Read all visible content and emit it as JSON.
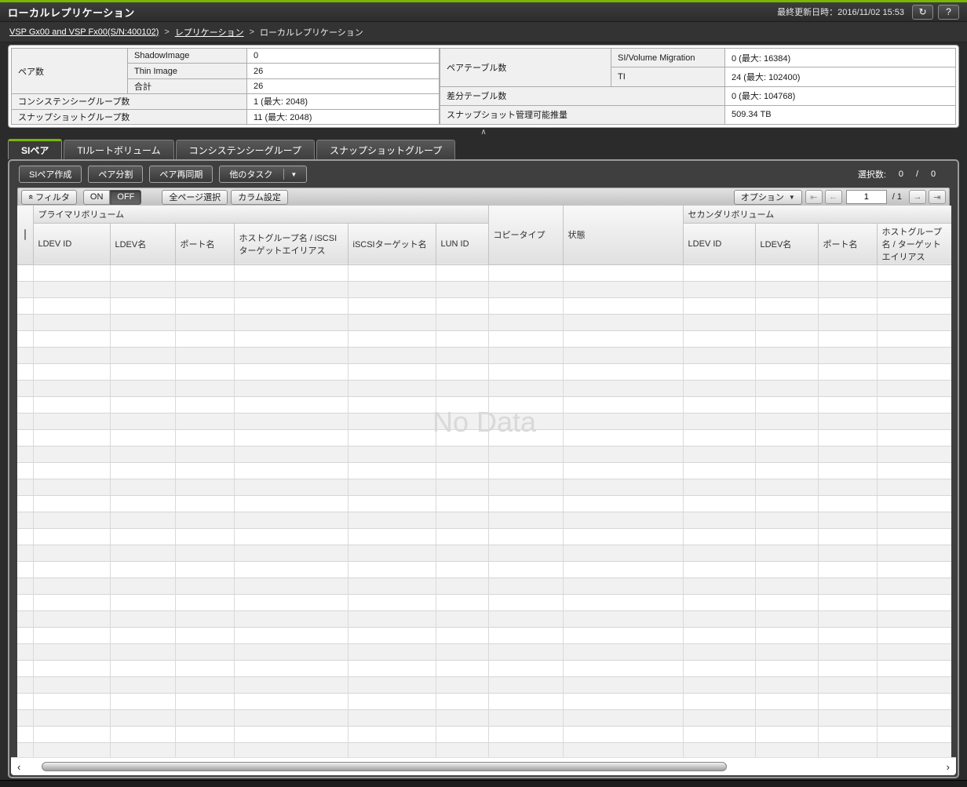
{
  "colors": {
    "accent_green": "#79b700",
    "panel_dark": "#3f3f3f",
    "no_data_gray": "#d9d9d9"
  },
  "title_bar": {
    "title": "ローカルレプリケーション",
    "last_updated": "最終更新日時：2016/11/02 15:53",
    "refresh_icon": "↻",
    "help_icon": "?"
  },
  "breadcrumb": {
    "separator": ">",
    "items": [
      {
        "label": "VSP Gx00 and VSP Fx00(S/N:400102)"
      },
      {
        "label": "レプリケーション"
      },
      {
        "label": "ローカルレプリケーション"
      }
    ]
  },
  "summary": {
    "left": {
      "pair_count_label": "ペア数",
      "rows": [
        {
          "label": "ShadowImage",
          "value": "0"
        },
        {
          "label": "Thin Image",
          "value": "26"
        },
        {
          "label": "合計",
          "value": "26"
        }
      ],
      "consistency_group_label": "コンシステンシーグループ数",
      "consistency_group_value": "1 (最大: 2048)",
      "snapshot_group_label": "スナップショットグループ数",
      "snapshot_group_value": "11 (最大: 2048)"
    },
    "right": {
      "pair_table_label": "ペアテーブル数",
      "rows": [
        {
          "label": "SI/Volume Migration",
          "value": "0 (最大: 16384)"
        },
        {
          "label": "TI",
          "value": "24 (最大: 102400)"
        }
      ],
      "diff_table_label": "差分テーブル数",
      "diff_table_value": "0 (最大: 104768)",
      "snapshot_capacity_label": "スナップショット管理可能推量",
      "snapshot_capacity_value": "509.34 TB"
    }
  },
  "collapse_icon": "∧",
  "tabs": [
    {
      "label": "SIペア",
      "active": true
    },
    {
      "label": "TIルートボリューム",
      "active": false
    },
    {
      "label": "コンシステンシーグループ",
      "active": false
    },
    {
      "label": "スナップショットグループ",
      "active": false
    }
  ],
  "toolbar": {
    "create_si_pair": "SIペア作成",
    "split_pair": "ペア分割",
    "resync_pair": "ペア再同期",
    "more_tasks": "他のタスク",
    "dropdown_arrow": "▼",
    "selection_label": "選択数:",
    "selected_count": "0",
    "selection_slash": "/",
    "total_count": "0"
  },
  "filter_bar": {
    "filter_label": "フィルタ",
    "filter_icon": "«",
    "on_label": "ON",
    "off_label": "OFF",
    "select_all_pages": "全ページ選択",
    "column_settings": "カラム設定",
    "options_label": "オプション",
    "dropdown_arrow": "▼",
    "first_icon": "⇤",
    "prev_icon": "←",
    "next_icon": "→",
    "last_icon": "⇥",
    "page_value": "1",
    "page_total": "/ 1"
  },
  "table": {
    "group_primary": "プライマリボリューム",
    "group_secondary": "セカンダリボリューム",
    "copy_type_label": "コピータイプ",
    "status_label": "状態",
    "primary_columns": [
      "LDEV ID",
      "LDEV名",
      "ポート名",
      "ホストグループ名 / iSCSIターゲットエイリアス",
      "iSCSIターゲット名",
      "LUN ID"
    ],
    "secondary_columns": [
      "LDEV ID",
      "LDEV名",
      "ポート名",
      "ホストグループ名 / ターゲットエイリアス"
    ],
    "no_data": "No Data",
    "row_count": 31,
    "column_count": 13
  },
  "scrollbar": {
    "left_icon": "‹",
    "right_icon": "›"
  }
}
